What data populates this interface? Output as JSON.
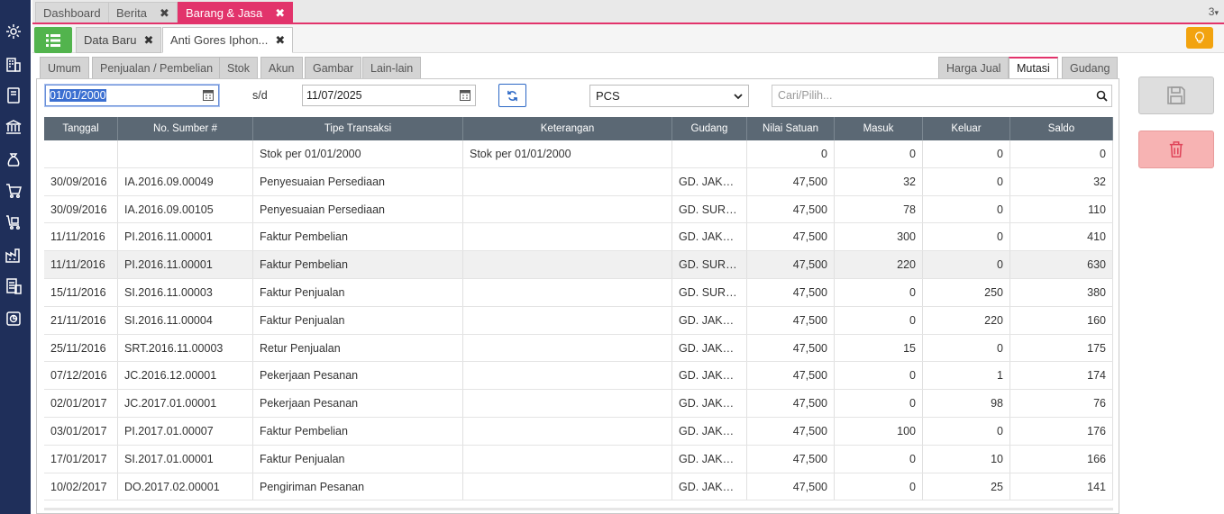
{
  "top_tabs": [
    {
      "label": "Dashboard",
      "closable": false,
      "active": false
    },
    {
      "label": "Berita",
      "closable": true,
      "active": false
    },
    {
      "label": "Barang & Jasa",
      "closable": true,
      "active": true
    }
  ],
  "tab_count": "3",
  "sub_tabs": [
    {
      "label": "Data Baru",
      "active": false
    },
    {
      "label": "Anti Gores Iphon...",
      "active": true
    }
  ],
  "close_glyph": "✖",
  "left_inner_tabs": [
    "Umum",
    "Penjualan / Pembelian",
    "Stok",
    "Akun",
    "Gambar",
    "Lain-lain"
  ],
  "right_inner_tabs": [
    "Harga Jual",
    "Mutasi",
    "Gudang"
  ],
  "active_inner_tab": "Mutasi",
  "filter": {
    "date_from": "01/01/2000",
    "separator": "s/d",
    "date_to": "11/07/2025",
    "unit": "PCS",
    "search_placeholder": "Cari/Pilih..."
  },
  "table": {
    "columns": [
      "Tanggal",
      "No. Sumber #",
      "Tipe Transaksi",
      "Keterangan",
      "Gudang",
      "Nilai Satuan",
      "Masuk",
      "Keluar",
      "Saldo"
    ],
    "rows": [
      [
        "",
        "",
        "Stok per 01/01/2000",
        "Stok per 01/01/2000",
        "",
        "0",
        "0",
        "0",
        "0"
      ],
      [
        "30/09/2016",
        "IA.2016.09.00049",
        "Penyesuaian Persediaan",
        "",
        "GD. JAKAR...",
        "47,500",
        "32",
        "0",
        "32"
      ],
      [
        "30/09/2016",
        "IA.2016.09.00105",
        "Penyesuaian Persediaan",
        "",
        "GD. SURAB...",
        "47,500",
        "78",
        "0",
        "110"
      ],
      [
        "11/11/2016",
        "PI.2016.11.00001",
        "Faktur Pembelian",
        "",
        "GD. JAKAR...",
        "47,500",
        "300",
        "0",
        "410"
      ],
      [
        "11/11/2016",
        "PI.2016.11.00001",
        "Faktur Pembelian",
        "",
        "GD. SURAB...",
        "47,500",
        "220",
        "0",
        "630"
      ],
      [
        "15/11/2016",
        "SI.2016.11.00003",
        "Faktur Penjualan",
        "",
        "GD. SURAB...",
        "47,500",
        "0",
        "250",
        "380"
      ],
      [
        "21/11/2016",
        "SI.2016.11.00004",
        "Faktur Penjualan",
        "",
        "GD. JAKAR...",
        "47,500",
        "0",
        "220",
        "160"
      ],
      [
        "25/11/2016",
        "SRT.2016.11.00003",
        "Retur Penjualan",
        "",
        "GD. JAKAR...",
        "47,500",
        "15",
        "0",
        "175"
      ],
      [
        "07/12/2016",
        "JC.2016.12.00001",
        "Pekerjaan Pesanan",
        "",
        "GD. JAKAR...",
        "47,500",
        "0",
        "1",
        "174"
      ],
      [
        "02/01/2017",
        "JC.2017.01.00001",
        "Pekerjaan Pesanan",
        "",
        "GD. JAKAR...",
        "47,500",
        "0",
        "98",
        "76"
      ],
      [
        "03/01/2017",
        "PI.2017.01.00007",
        "Faktur Pembelian",
        "",
        "GD. JAKAR...",
        "47,500",
        "100",
        "0",
        "176"
      ],
      [
        "17/01/2017",
        "SI.2017.01.00001",
        "Faktur Penjualan",
        "",
        "GD. JAKAR...",
        "47,500",
        "0",
        "10",
        "166"
      ],
      [
        "10/02/2017",
        "DO.2017.02.00001",
        "Pengiriman Pesanan",
        "",
        "GD. JAKAR...",
        "47,500",
        "0",
        "25",
        "141"
      ]
    ]
  },
  "sidebar_icons": [
    "gear-icon",
    "building-icon",
    "book-icon",
    "bank-icon",
    "money-bag-icon",
    "cart-icon",
    "delivery-cart-icon",
    "factory-icon",
    "tax-document-icon",
    "report-icon"
  ],
  "colors": {
    "accent": "#e2336b",
    "sidebar": "#1f2f5a",
    "menu_button": "#52b44d",
    "table_header": "#5b6874",
    "delete": "#f7b3b3",
    "bulb": "#f2a30f"
  }
}
